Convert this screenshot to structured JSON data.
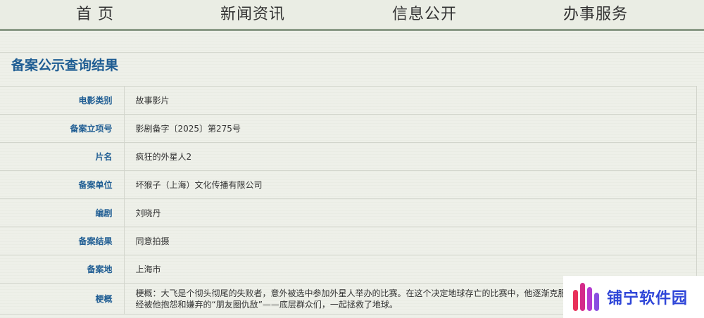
{
  "nav": {
    "items": [
      "首 页",
      "新闻资讯",
      "信息公开",
      "办事服务"
    ]
  },
  "page_title": "备案公示查询结果",
  "rows": [
    {
      "label": "电影类别",
      "value": "故事影片"
    },
    {
      "label": "备案立项号",
      "value": "影剧备字〔2025〕第275号"
    },
    {
      "label": "片名",
      "value": "疯狂的外星人2"
    },
    {
      "label": "备案单位",
      "value": "坏猴子（上海）文化传播有限公司"
    },
    {
      "label": "编剧",
      "value": "刘晓丹"
    },
    {
      "label": "备案结果",
      "value": "同意拍摄"
    },
    {
      "label": "备案地",
      "value": "上海市"
    },
    {
      "label": "梗概",
      "value": "梗概：大飞是个彻头彻尾的失败者，意外被选中参加外星人举办的比赛。在这个决定地球存亡的比赛中，他逐渐克服自我，不再轻言放弃，最终联合曾经被他抱怨和嫌弃的“朋友圈仇敌”——底层群众们，一起拯救了地球。"
    }
  ],
  "watermark": {
    "text": "铺宁软件园"
  },
  "colors": {
    "accent": "#1f5d93",
    "nav_border": "#8a9a86",
    "watermark_text": "#2f46d8"
  }
}
